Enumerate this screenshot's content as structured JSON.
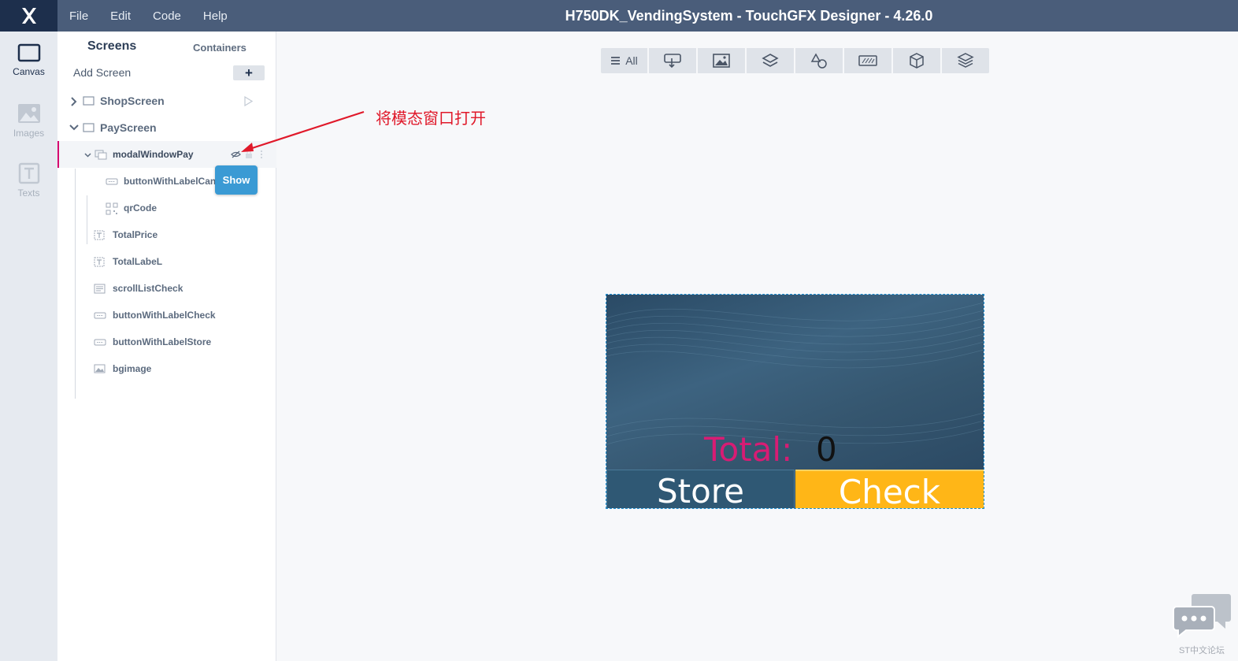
{
  "app": {
    "window_title": "H750DK_VendingSystem - TouchGFX Designer - 4.26.0",
    "menu": [
      "File",
      "Edit",
      "Code",
      "Help"
    ]
  },
  "rail": [
    {
      "label": "Canvas",
      "icon": "canvas-icon",
      "active": true
    },
    {
      "label": "Images",
      "icon": "image-icon",
      "active": false
    },
    {
      "label": "Texts",
      "icon": "text-icon",
      "active": false
    }
  ],
  "panel": {
    "tabs": {
      "screens": "Screens",
      "containers": "Containers"
    },
    "add_screen": "Add Screen",
    "add_button": "+",
    "screens": [
      {
        "name": "ShopScreen",
        "expanded": false
      },
      {
        "name": "PayScreen",
        "expanded": true
      }
    ],
    "widgets": {
      "modal": "modalWindowPay",
      "cancel": "buttonWithLabelCanc",
      "qr": "qrCode",
      "total_price": "TotalPrice",
      "total_label": "TotalLabeL",
      "scroll_list": "scrollListCheck",
      "btn_check": "buttonWithLabelCheck",
      "btn_store": "buttonWithLabelStore",
      "bg": "bgimage"
    },
    "tooltip": "Show"
  },
  "toolbar": {
    "all_label": "All",
    "buttons": [
      "interaction-icon",
      "image-icon",
      "layers-icon",
      "shapes-icon",
      "keyboard-icon",
      "cube-icon",
      "stack-icon"
    ]
  },
  "annotation": "将模态窗口打开",
  "canvas": {
    "total_label": "Total:",
    "total_value": "0",
    "store_button": "Store",
    "check_button": "Check",
    "colors": {
      "total_label": "#d81c74",
      "store_bg": "#2f5874",
      "check_bg": "#ffb617"
    }
  },
  "watermark": "ST中文论坛"
}
